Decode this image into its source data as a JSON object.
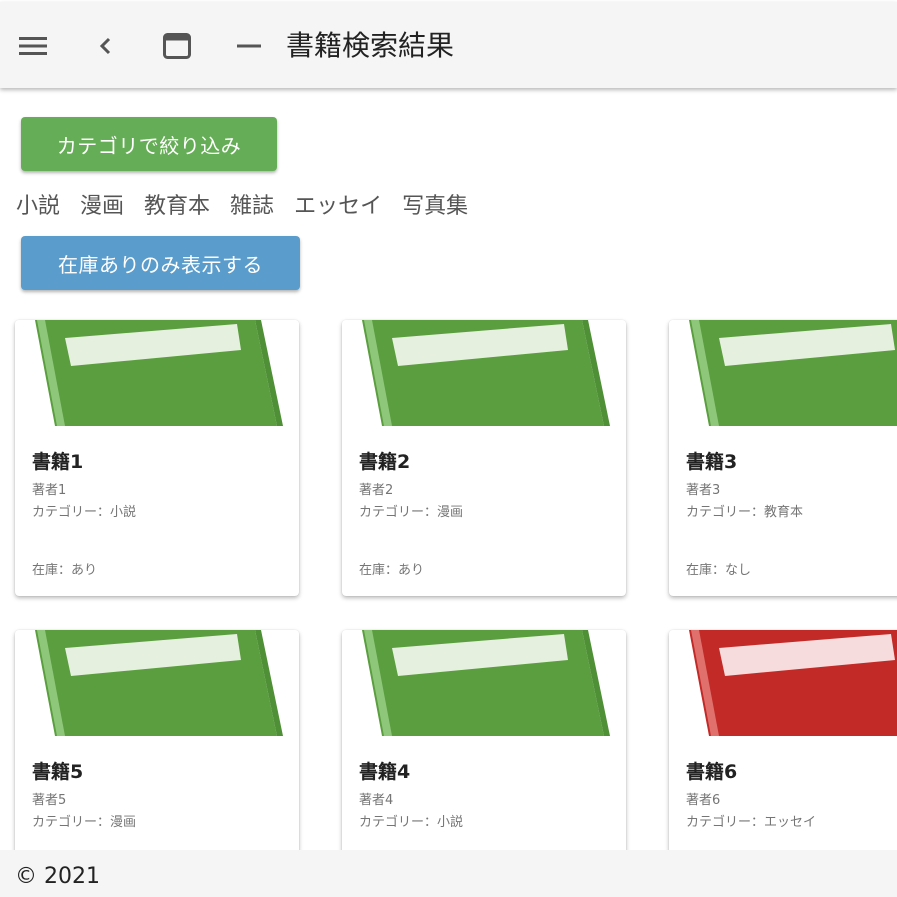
{
  "header": {
    "title": "書籍検索結果",
    "icons": [
      "menu-icon",
      "back-icon",
      "window-icon",
      "minimize-icon"
    ]
  },
  "filters": {
    "filter_button_label": "カテゴリで絞り込み",
    "categories": [
      "小説",
      "漫画",
      "教育本",
      "雑誌",
      "エッセイ",
      "写真集"
    ],
    "stock_button_label": "在庫ありのみ表示する",
    "filter_button_color": "#66ad57",
    "stock_button_color": "#5a9ccc"
  },
  "books": [
    {
      "title": "書籍1",
      "author": "著者1",
      "category": "カテゴリー：小説",
      "stock": "在庫：あり",
      "cover_color": "green"
    },
    {
      "title": "書籍2",
      "author": "著者2",
      "category": "カテゴリー：漫画",
      "stock": "在庫：あり",
      "cover_color": "green"
    },
    {
      "title": "書籍3",
      "author": "著者3",
      "category": "カテゴリー：教育本",
      "stock": "在庫：なし",
      "cover_color": "green"
    },
    {
      "title": "書籍5",
      "author": "著者5",
      "category": "カテゴリー：漫画",
      "stock": "",
      "cover_color": "green"
    },
    {
      "title": "書籍4",
      "author": "著者4",
      "category": "カテゴリー：小説",
      "stock": "",
      "cover_color": "green"
    },
    {
      "title": "書籍6",
      "author": "著者6",
      "category": "カテゴリー：エッセイ",
      "stock": "",
      "cover_color": "red"
    }
  ],
  "footer": {
    "copyright": "© 2021"
  }
}
